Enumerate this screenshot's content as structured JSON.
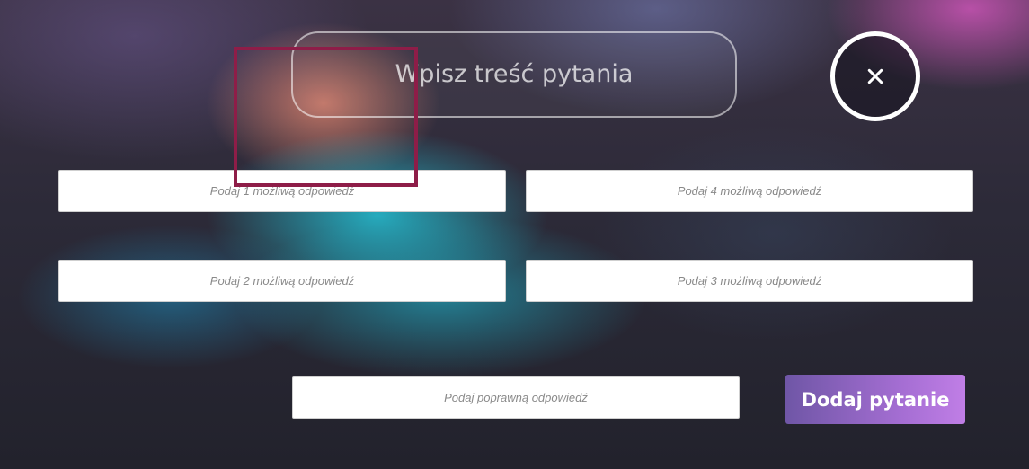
{
  "question": {
    "placeholder": "Wpisz treść pytania"
  },
  "close_button": {
    "icon": "close-icon"
  },
  "answers": {
    "answer_1_placeholder": "Podaj 1 możliwą odpowiedź",
    "answer_2_placeholder": "Podaj 2 możliwą odpowiedź",
    "answer_3_placeholder": "Podaj 3 możliwą odpowiedź",
    "answer_4_placeholder": "Podaj 4 możliwą odpowiedź"
  },
  "correct_answer": {
    "placeholder": "Podaj poprawną odpowiedź"
  },
  "submit": {
    "label": "Dodaj pytanie"
  },
  "colors": {
    "button_gradient_start": "#6f56a6",
    "button_gradient_end": "#c07ee6",
    "selection_outline": "#8e1d48",
    "input_background": "#ffffff"
  }
}
